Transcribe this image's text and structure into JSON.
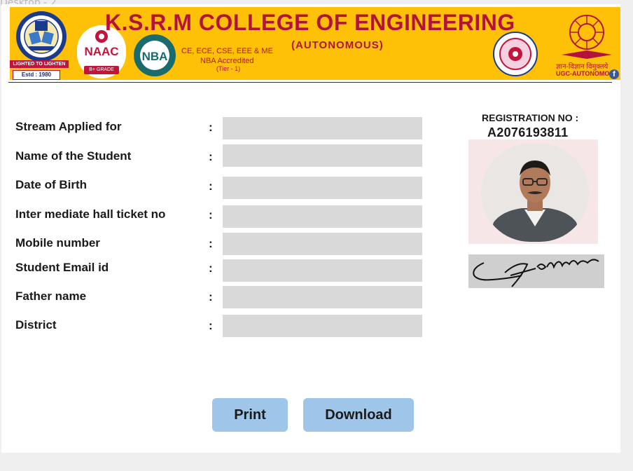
{
  "frame": {
    "title": "Desktop - 2"
  },
  "header": {
    "college_name": "K.S.R.M COLLEGE OF ENGINEERING",
    "autonomous": "(AUTONOMOUS)",
    "accreditation_line1": "CE, ECE, CSE, EEE & ME",
    "accreditation_line2": "NBA Accredited",
    "accreditation_line3": "(Tier - 1)",
    "motto": "LIGHTED TO LIGHTEN",
    "established": "Estd : 1980",
    "naac": "NAAC",
    "naac_grade": "B+ GRADE",
    "nba": "NBA",
    "ugc_hindi": "ज्ञान-विज्ञान विमुक्तये",
    "ugc_text": "UGC-AUTONOMOUS",
    "accent_color": "#b3133a",
    "banner_color": "#ffc107"
  },
  "form": {
    "fields": [
      {
        "label": "Stream Applied for",
        "value": ""
      },
      {
        "label": "Name of the Student",
        "value": ""
      },
      {
        "label": "Date of Birth",
        "value": ""
      },
      {
        "label": "Inter mediate hall ticket no",
        "value": ""
      },
      {
        "label": "Mobile number",
        "value": ""
      },
      {
        "label": "Student Email id",
        "value": ""
      },
      {
        "label": "Father name",
        "value": ""
      },
      {
        "label": "District",
        "value": ""
      }
    ],
    "separator": ":"
  },
  "registration": {
    "label": "REGISTRATION  NO :",
    "number": "A2076193811"
  },
  "actions": {
    "print_label": "Print",
    "download_label": "Download",
    "button_color": "#9fc5e8"
  },
  "icons": [
    "college-logo-icon",
    "naac-logo-icon",
    "nba-logo-icon",
    "jntu-logo-icon",
    "ugc-logo-icon",
    "facebook-icon",
    "student-photo",
    "signature-image"
  ]
}
